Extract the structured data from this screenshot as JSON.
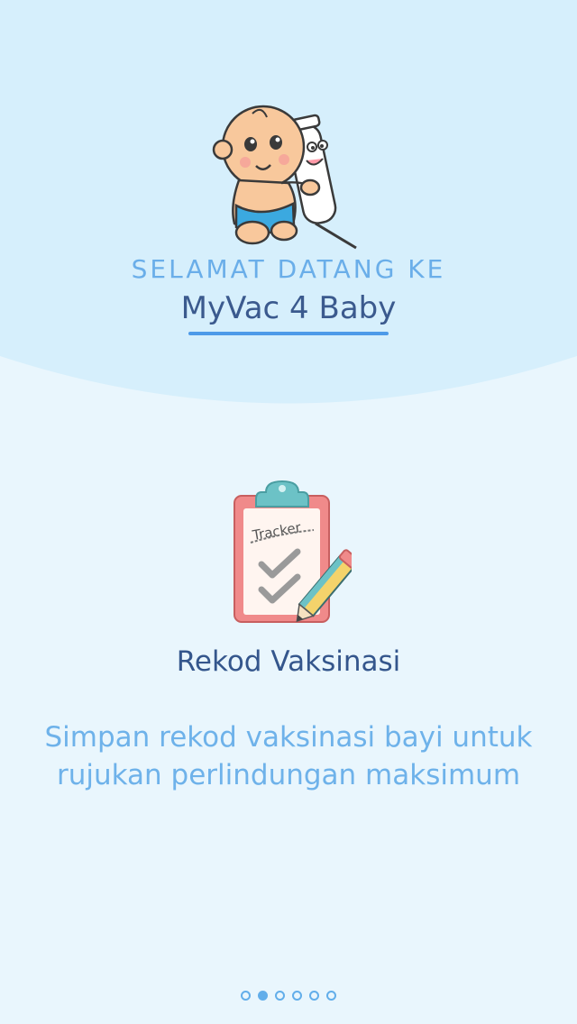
{
  "header": {
    "welcome_text": "SELAMAT DATANG KE",
    "app_name": "MyVac 4 Baby"
  },
  "slide": {
    "icon_text": "Tracker",
    "title": "Rekod Vaksinasi",
    "description": "Simpan rekod vaksinasi bayi untuk rujukan perlindungan maksimum"
  },
  "pager": {
    "total": 6,
    "active_index": 1
  },
  "colors": {
    "top_background": "#d6effc",
    "page_background": "#e9f6fd",
    "accent": "#62aeea",
    "title_text": "#34568c"
  }
}
